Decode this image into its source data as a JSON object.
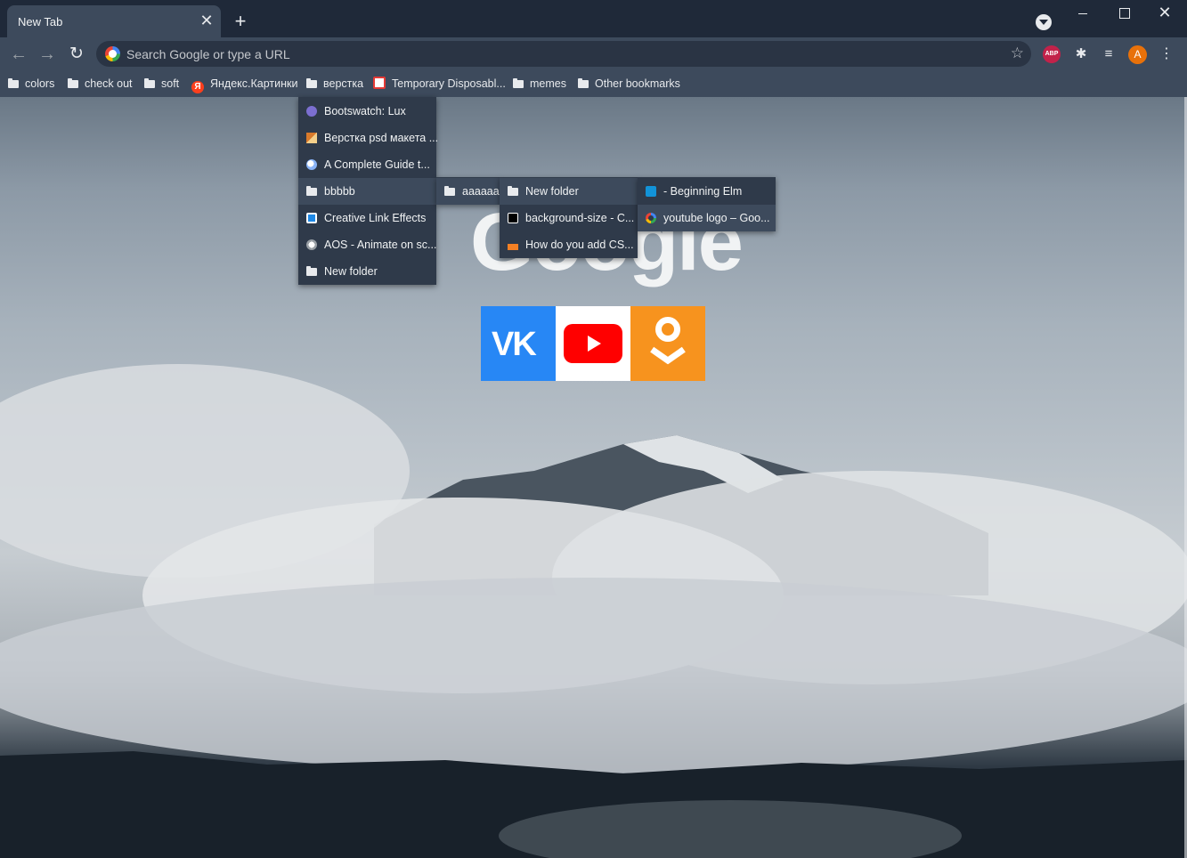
{
  "tab": {
    "title": "New Tab",
    "close_symbol": "✕",
    "new_tab_symbol": "+"
  },
  "window": {
    "close_symbol": "✕"
  },
  "toolbar": {
    "back_symbol": "←",
    "forward_symbol": "→",
    "reload_symbol": "↻",
    "omnibox_placeholder": "Search Google or type a URL",
    "star_symbol": "☆",
    "abp_label": "ABP",
    "puzzle_symbol": "✱",
    "media_symbol": "≡",
    "avatar_letter": "A",
    "menu_symbol": "⋮"
  },
  "bookmarks": [
    {
      "label": "colors",
      "icon": "folder-icon"
    },
    {
      "label": "check out",
      "icon": "folder-icon"
    },
    {
      "label": "soft",
      "icon": "folder-icon"
    },
    {
      "label": "Яндекс.Картинки",
      "icon": "yandex-icon",
      "icon_text": "Я"
    },
    {
      "label": "верстка",
      "icon": "folder-icon"
    },
    {
      "label": "Temporary Disposabl...",
      "icon": "mail-icon"
    },
    {
      "label": "memes",
      "icon": "folder-icon"
    },
    {
      "label": "Other bookmarks",
      "icon": "folder-icon"
    }
  ],
  "ntp": {
    "logo_text": "Google",
    "shortcuts": [
      {
        "name": "VK",
        "icon": "vk-icon",
        "text": "VK",
        "color": "#2787f5"
      },
      {
        "name": "YouTube",
        "icon": "youtube-icon",
        "color": "#ff0000"
      },
      {
        "name": "Odnoklassniki",
        "icon": "ok-icon",
        "color": "#f7931e"
      }
    ]
  },
  "menus": {
    "verstka": [
      {
        "label": "Bootswatch: Lux",
        "icon": "bootswatch-icon"
      },
      {
        "label": "Верстка psd макета ...",
        "icon": "psd-icon"
      },
      {
        "label": "A Complete Guide t...",
        "icon": "globe-icon"
      },
      {
        "label": "bbbbb",
        "icon": "folder-icon"
      },
      {
        "label": "Creative Link Effects",
        "icon": "creative-icon"
      },
      {
        "label": "AOS - Animate on sc...",
        "icon": "aos-icon"
      },
      {
        "label": "New folder",
        "icon": "folder-icon"
      }
    ],
    "bbbbb": [
      {
        "label": "aaaaaa",
        "icon": "folder-icon"
      }
    ],
    "aaaaaa": [
      {
        "label": "New folder",
        "icon": "folder-icon"
      },
      {
        "label": "background-size - C...",
        "icon": "mdn-icon"
      },
      {
        "label": "How do you add CS...",
        "icon": "stackoverflow-icon"
      }
    ],
    "new_folder": [
      {
        "label": "- Beginning Elm",
        "icon": "elm-icon"
      },
      {
        "label": "youtube logo – Goo...",
        "icon": "google-icon"
      }
    ]
  }
}
